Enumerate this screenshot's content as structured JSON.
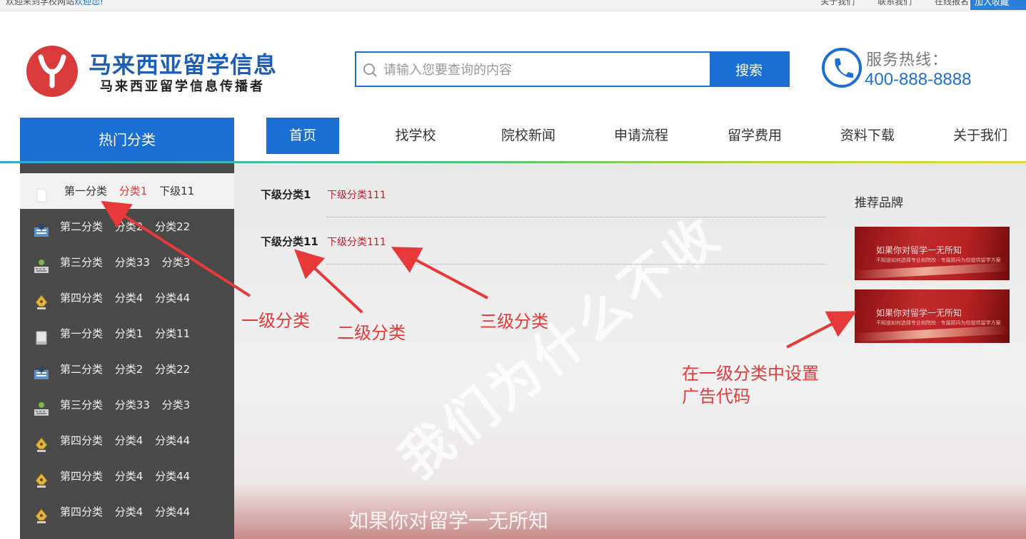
{
  "topbar": {
    "welcome_prefix": "欢迎来到学校网站",
    "welcome_link": "欢迎您!",
    "links": [
      "关于我们",
      "联系我们",
      "在线报名"
    ],
    "join": "加入收藏"
  },
  "logo": {
    "title": "马来西亚留学信息",
    "subtitle": "马来西亚留学信息传播者"
  },
  "search": {
    "placeholder": "请输入您要查询的内容",
    "button": "搜索"
  },
  "hotline": {
    "label": "服务热线：",
    "number": "400-888-8888"
  },
  "nav": {
    "hot_category": "热门分类",
    "items": [
      {
        "label": "首页",
        "active": true
      },
      {
        "label": "找学校"
      },
      {
        "label": "院校新闻"
      },
      {
        "label": "申请流程"
      },
      {
        "label": "留学费用"
      },
      {
        "label": "资料下载"
      },
      {
        "label": "关于我们"
      }
    ]
  },
  "sidebar": {
    "items": [
      {
        "icon": "document-icon",
        "name": "第一分类",
        "sub1": "分类1",
        "sub2": "下级11",
        "active": true
      },
      {
        "icon": "newspaper-icon",
        "name": "第二分类",
        "sub1": "分类2",
        "sub2": "分类22"
      },
      {
        "icon": "keyboard-icon",
        "name": "第三分类",
        "sub1": "分类33",
        "sub2": "分类3"
      },
      {
        "icon": "pen-nib-icon",
        "name": "第四分类",
        "sub1": "分类4",
        "sub2": "分类44"
      },
      {
        "icon": "book-icon",
        "name": "第一分类",
        "sub1": "分类1",
        "sub2": "分类11"
      },
      {
        "icon": "newspaper-icon",
        "name": "第二分类",
        "sub1": "分类2",
        "sub2": "分类22"
      },
      {
        "icon": "keyboard-icon",
        "name": "第三分类",
        "sub1": "分类33",
        "sub2": "分类3"
      },
      {
        "icon": "pen-nib-icon",
        "name": "第四分类",
        "sub1": "分类4",
        "sub2": "分类44"
      },
      {
        "icon": "pen-nib-icon",
        "name": "第四分类",
        "sub1": "分类4",
        "sub2": "分类44"
      },
      {
        "icon": "pen-nib-icon",
        "name": "第四分类",
        "sub1": "分类4",
        "sub2": "分类44"
      }
    ]
  },
  "submenu": {
    "rows": [
      {
        "name": "下级分类1",
        "leaf": "下级分类111"
      },
      {
        "name": "下级分类11",
        "leaf": "下级分类111"
      }
    ]
  },
  "brands": {
    "title": "推荐品牌",
    "ads": [
      {
        "headline": "如果你对留学一无所知",
        "small": "不知道如何选择专业和院校 · 专属顾问为你提供留学方案"
      },
      {
        "headline": "如果你对留学一无所知",
        "small": "不知道如何选择专业和院校 · 专属顾问为你提供留学方案"
      }
    ]
  },
  "background_watermark": {
    "slogan": "我们为什么不收",
    "bottom": "如果你对留学一无所知"
  },
  "annotations": {
    "level1": "一级分类",
    "level2": "二级分类",
    "level3": "三级分类",
    "ad_code_line1": "在一级分类中设置",
    "ad_code_line2": "广告代码"
  },
  "colors": {
    "primary": "#1c6fd2",
    "sidebar": "#4a4a4a",
    "accent_red": "#d63a3a",
    "annotation": "#e8393a"
  }
}
